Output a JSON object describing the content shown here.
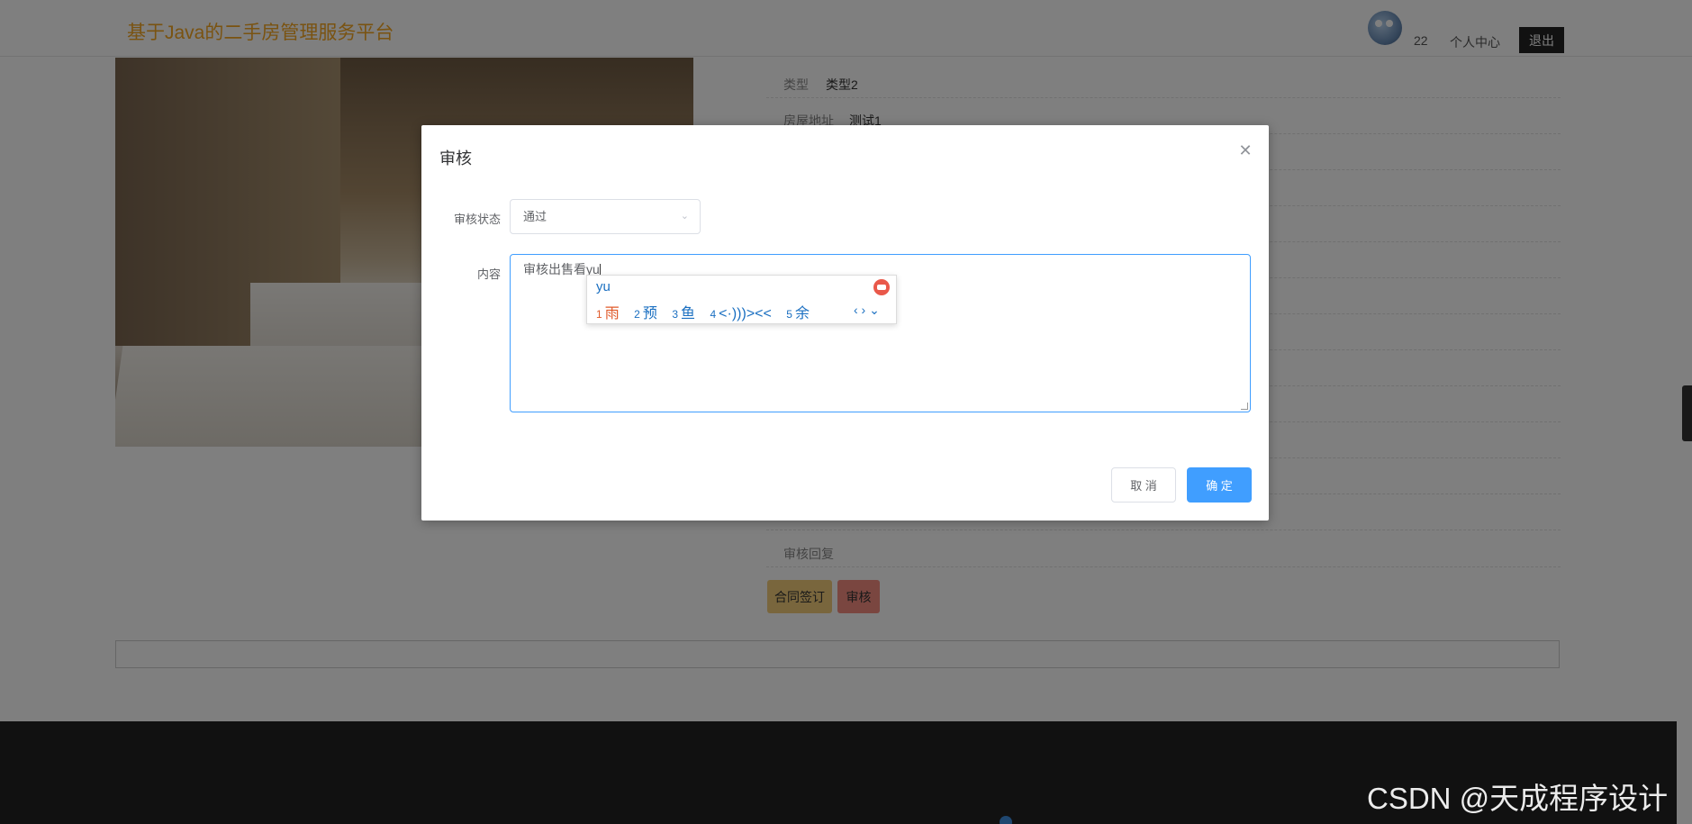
{
  "header": {
    "brand": "基于Java的二手房管理服务平台",
    "user_number": "22",
    "personal_center": "个人中心",
    "logout": "退出"
  },
  "details": {
    "type_label": "类型",
    "type_value": "类型2",
    "address_label": "房屋地址",
    "address_value": "测试1",
    "review_reply_label": "审核回复"
  },
  "actions": {
    "contract": "合同签订",
    "review": "审核"
  },
  "dialog": {
    "title": "审核",
    "close_icon": "close-icon",
    "status_label": "审核状态",
    "status_value": "通过",
    "content_label": "内容",
    "content_value": "审核出售看yu",
    "cancel": "取 消",
    "confirm": "确 定"
  },
  "ime": {
    "input": "yu",
    "candidates": [
      {
        "num": "1",
        "text": "雨"
      },
      {
        "num": "2",
        "text": "预"
      },
      {
        "num": "3",
        "text": "鱼"
      },
      {
        "num": "4",
        "text": "<·)))><<"
      },
      {
        "num": "5",
        "text": "余"
      }
    ],
    "nav": "‹ › ⌄"
  },
  "watermark": "CSDN @天成程序设计"
}
